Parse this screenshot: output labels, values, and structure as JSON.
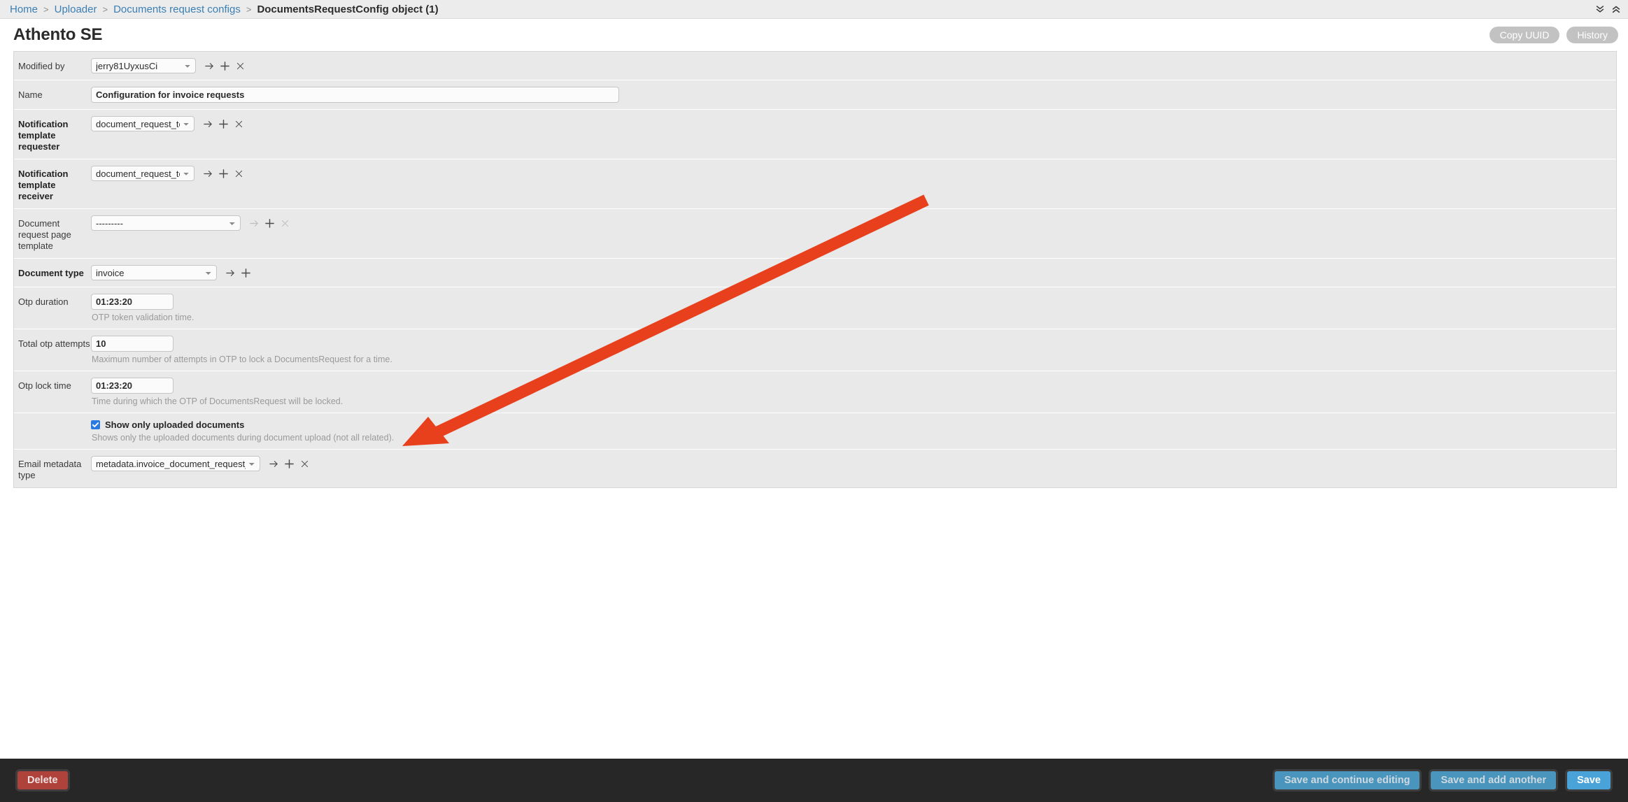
{
  "breadcrumb": {
    "items": [
      {
        "label": "Home",
        "link": true
      },
      {
        "label": "Uploader",
        "link": true
      },
      {
        "label": "Documents request configs",
        "link": true
      },
      {
        "label": "DocumentsRequestConfig object (1)",
        "link": false
      }
    ],
    "separator": ">",
    "tools": {
      "collapse_all": "chevron-double-down-icon",
      "expand_all": "chevron-double-up-icon"
    }
  },
  "header": {
    "title": "Athento SE",
    "copy_uuid_label": "Copy UUID",
    "history_label": "History"
  },
  "form": {
    "rows": [
      {
        "label": "Modified by",
        "required": false,
        "control": "select",
        "value": "jerry81UyxusCi",
        "icons": [
          "arrow-right-icon",
          "plus-icon",
          "close-icon"
        ],
        "icons_dim": false,
        "help": ""
      },
      {
        "label": "Name",
        "required": false,
        "control": "text",
        "value": "Configuration for invoice requests",
        "icons": [],
        "help": ""
      },
      {
        "label": "Notification template requester",
        "required": true,
        "control": "select",
        "value": "document_request_template",
        "icons": [
          "arrow-right-icon",
          "plus-icon",
          "close-icon"
        ],
        "icons_dim": false,
        "help": ""
      },
      {
        "label": "Notification template receiver",
        "required": true,
        "control": "select",
        "value": "document_request_template",
        "icons": [
          "arrow-right-icon",
          "plus-icon",
          "close-icon"
        ],
        "icons_dim": false,
        "help": ""
      },
      {
        "label": "Document request page template",
        "required": false,
        "control": "select",
        "value": "---------",
        "icons": [
          "arrow-right-icon",
          "plus-icon",
          "close-icon"
        ],
        "icons_dim": true,
        "help": ""
      },
      {
        "label": "Document type",
        "required": true,
        "control": "select",
        "value": "invoice",
        "icons": [
          "arrow-right-icon",
          "plus-icon"
        ],
        "icons_dim": false,
        "help": ""
      },
      {
        "label": "Otp duration",
        "required": false,
        "control": "text-small",
        "value": "01:23:20",
        "icons": [],
        "help": "OTP token validation time."
      },
      {
        "label": "Total otp attempts",
        "required": false,
        "control": "text-small",
        "value": "10",
        "icons": [],
        "help": "Maximum number of attempts in OTP to lock a DocumentsRequest for a time."
      },
      {
        "label": "Otp lock time",
        "required": false,
        "control": "text-small",
        "value": "01:23:20",
        "icons": [],
        "help": "Time during which the OTP of DocumentsRequest will be locked."
      },
      {
        "label": "",
        "required": false,
        "control": "checkbox",
        "value": "Show only uploaded documents",
        "checked": true,
        "icons": [],
        "help": "Shows only the uploaded documents during document upload (not all related)."
      },
      {
        "label": "Email metadata type",
        "required": false,
        "control": "select",
        "value": "metadata.invoice_document_request_email",
        "icons": [
          "arrow-right-icon",
          "plus-icon",
          "close-icon"
        ],
        "icons_dim": false,
        "help": ""
      }
    ]
  },
  "annotation": {
    "color": "#e8401c",
    "type": "arrow",
    "points_at": "Email metadata type dropdown"
  },
  "footer": {
    "delete_label": "Delete",
    "save_continue_label": "Save and continue editing",
    "save_add_another_label": "Save and add another",
    "save_label": "Save"
  }
}
